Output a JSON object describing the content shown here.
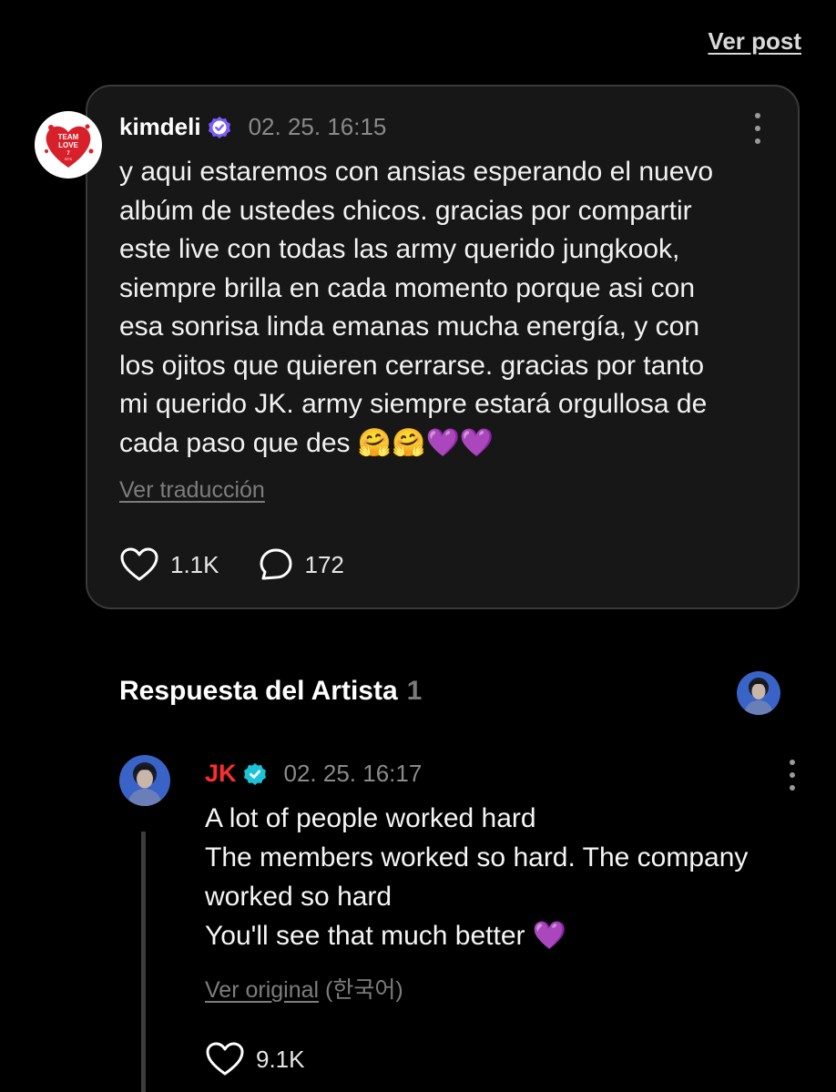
{
  "header": {
    "view_post_label": "Ver post"
  },
  "post": {
    "avatar_text": [
      "TEAM",
      "LOVE",
      "7",
      "BTS"
    ],
    "username": "kimdeli",
    "timestamp": "02. 25. 16:15",
    "body": "y aqui estaremos con ansias esperando el nuevo\nalbúm de ustedes chicos. gracias por compartir\neste live con todas las army querido jungkook,\nsiempre brilla en cada momento porque asi con\nesa sonrisa linda emanas mucha energía, y con\nlos ojitos que quieren cerrarse. gracias por tanto\nmi querido JK. army siempre estará orgullosa de\ncada paso que des 🤗🤗💜💜",
    "translate_label": "Ver traducción",
    "likes": "1.1K",
    "comments": "172"
  },
  "artist_section": {
    "title": "Respuesta del Artista",
    "count": "1"
  },
  "reply": {
    "artist_name": "JK",
    "timestamp": "02. 25. 16:17",
    "lines": [
      "A lot of people worked hard",
      "The members worked so hard. The company",
      "worked so hard",
      "You'll see that much better 💜"
    ],
    "view_original_label": "Ver original",
    "original_language": "(한국어)",
    "likes": "9.1K"
  },
  "colors": {
    "background": "#000000",
    "card_background": "#171717",
    "card_border": "#3a3a3a",
    "artist_name": "#ff2d2d",
    "verified_fan_badge": "#7b5cff",
    "verified_artist_badge": "#19c4d9",
    "muted_text": "#8a8a8a"
  },
  "icons": {
    "like": "heart-outline-icon",
    "comment": "speech-bubble-icon",
    "more": "vertical-dots-icon",
    "fan_badge": "verified-badge-icon",
    "artist_badge": "verified-check-icon"
  }
}
